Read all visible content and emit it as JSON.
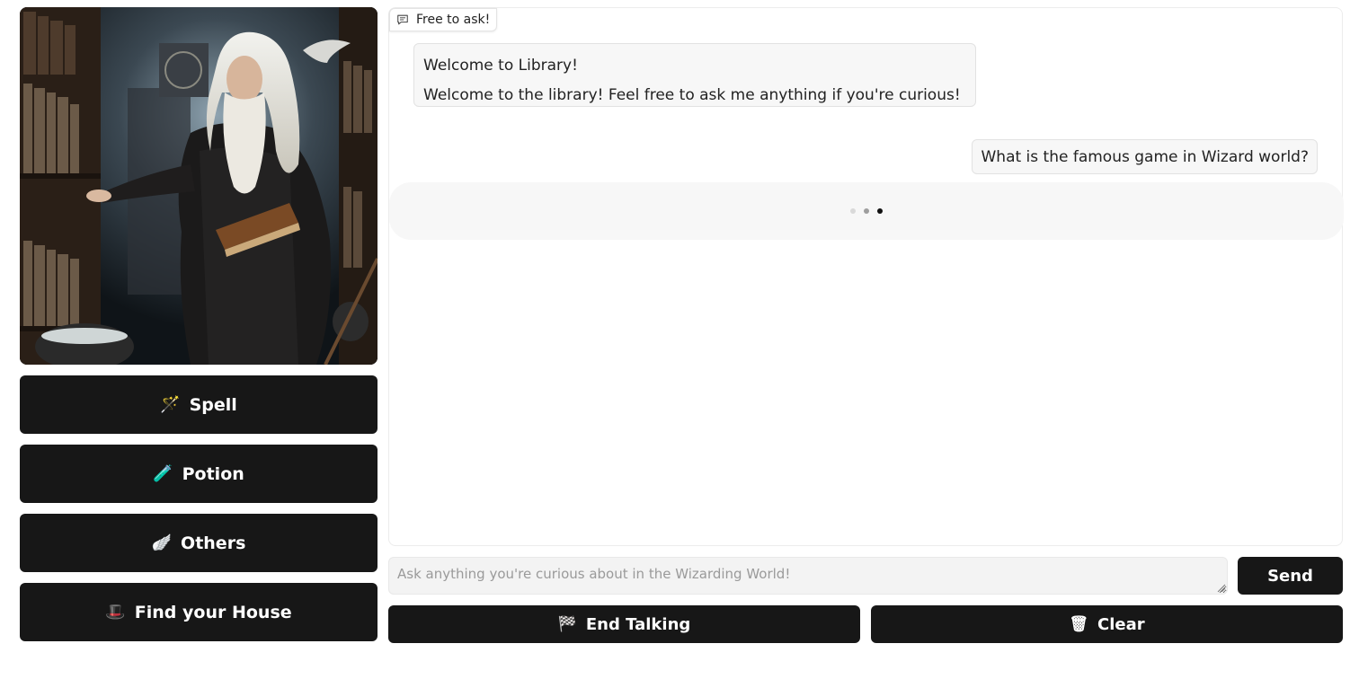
{
  "sidebar": {
    "portrait_alt": "Wizard librarian",
    "buttons": [
      {
        "icon": "magic-wand-icon",
        "glyph": "🪄",
        "label": "Spell"
      },
      {
        "icon": "potion-icon",
        "glyph": "🧪",
        "label": "Potion"
      },
      {
        "icon": "golden-snitch-icon",
        "glyph": "🪽",
        "label": "Others"
      },
      {
        "icon": "wizard-hat-icon",
        "glyph": "🎩",
        "label": "Find your House"
      }
    ]
  },
  "chat": {
    "label": "Free to ask!",
    "messages": [
      {
        "role": "bot",
        "lines": [
          "Welcome to Library!",
          "Welcome to the library! Feel free to ask me anything if you're curious!"
        ]
      },
      {
        "role": "user",
        "text": "What is the famous game in Wizard world?"
      }
    ],
    "pending_dots": [
      "#d9d9d9",
      "#9e9e9e",
      "#111111"
    ]
  },
  "composer": {
    "placeholder": "Ask anything you're curious about in the Wizarding World!",
    "value": "",
    "send_label": "Send"
  },
  "actions": {
    "end": {
      "icon": "checkered-flag-icon",
      "glyph": "🏁",
      "label": "End Talking"
    },
    "clear": {
      "icon": "wastebasket-icon",
      "glyph": "🗑",
      "label": "Clear"
    }
  },
  "colors": {
    "button_bg": "#171717",
    "button_text": "#ffffff",
    "bubble_bg": "#f7f7f7",
    "bubble_border": "#e2e2e2"
  }
}
